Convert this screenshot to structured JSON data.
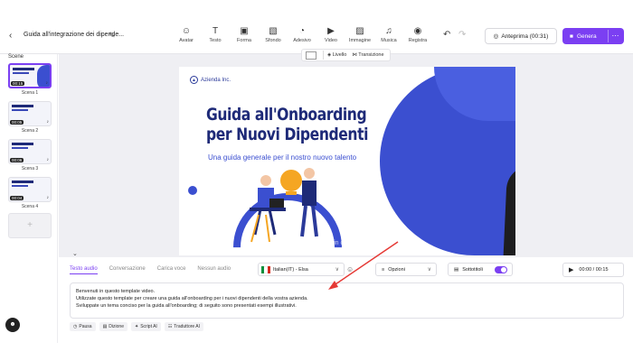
{
  "header": {
    "back_icon": "chevron-left-icon",
    "doc_title": "Guida all'integrazione dei dipende...",
    "tools": [
      {
        "label": "Avatar",
        "icon": "☺"
      },
      {
        "label": "Testo",
        "icon": "T"
      },
      {
        "label": "Forma",
        "icon": "▣"
      },
      {
        "label": "Sfondo",
        "icon": "▧"
      },
      {
        "label": "Adesivo",
        "icon": "◔"
      },
      {
        "label": "Video",
        "icon": "▶"
      },
      {
        "label": "Immagine",
        "icon": "▨"
      },
      {
        "label": "Musica",
        "icon": "♫"
      },
      {
        "label": "Registra",
        "icon": "◉"
      }
    ],
    "preview_label": "Anteprima (00:31)",
    "generate_label": "Genera",
    "more_label": "⋯"
  },
  "sidebar": {
    "title": "Scene",
    "scenes": [
      {
        "label": "Scena 1",
        "duration": "00:15"
      },
      {
        "label": "Scena 2",
        "duration": "00:05"
      },
      {
        "label": "Scena 3",
        "duration": "00:06"
      },
      {
        "label": "Scena 4",
        "duration": "00:04"
      }
    ],
    "add_label": "+"
  },
  "canvas": {
    "toolbar": {
      "level_label": "Livello",
      "transition_label": "Transizione"
    },
    "slide": {
      "logo_text": "Azienda Inc.",
      "title_line1": "Guida all'Onboarding",
      "title_line2": "per Nuovi Dipendenti",
      "subtitle": "Una guida generale per il nostro nuovo talento",
      "watermark": "Benvenuti in questo template video."
    }
  },
  "editor": {
    "tabs": [
      "Testo audio",
      "Conversazione",
      "Carica voce",
      "Nessun audio"
    ],
    "active_tab": "Testo audio",
    "voice": "Italian(IT) - Elsa",
    "options_label": "Opzioni",
    "subtitles_label": "Sottotitoli",
    "subtitles_on": true,
    "time": "00:00 / 00:15",
    "script_lines": [
      "Benvenuti in questo template video.",
      "Utilizzate questo template per creare una guida all'onboarding per i nuovi dipendenti della vostra azienda.",
      "Sviluppate un tema conciso per la guida all'onboarding; di seguito sono presentati esempi illustrativi."
    ],
    "actions": [
      {
        "label": "Pausa",
        "icon": "◷"
      },
      {
        "label": "Dizione",
        "icon": "▤"
      },
      {
        "label": "Script AI",
        "icon": "✦"
      },
      {
        "label": "Traduttore AI",
        "icon": "☷"
      }
    ]
  },
  "colors": {
    "accent": "#7b3ff2",
    "brand_blue": "#3b4fd0",
    "annotation": "#e53935"
  }
}
